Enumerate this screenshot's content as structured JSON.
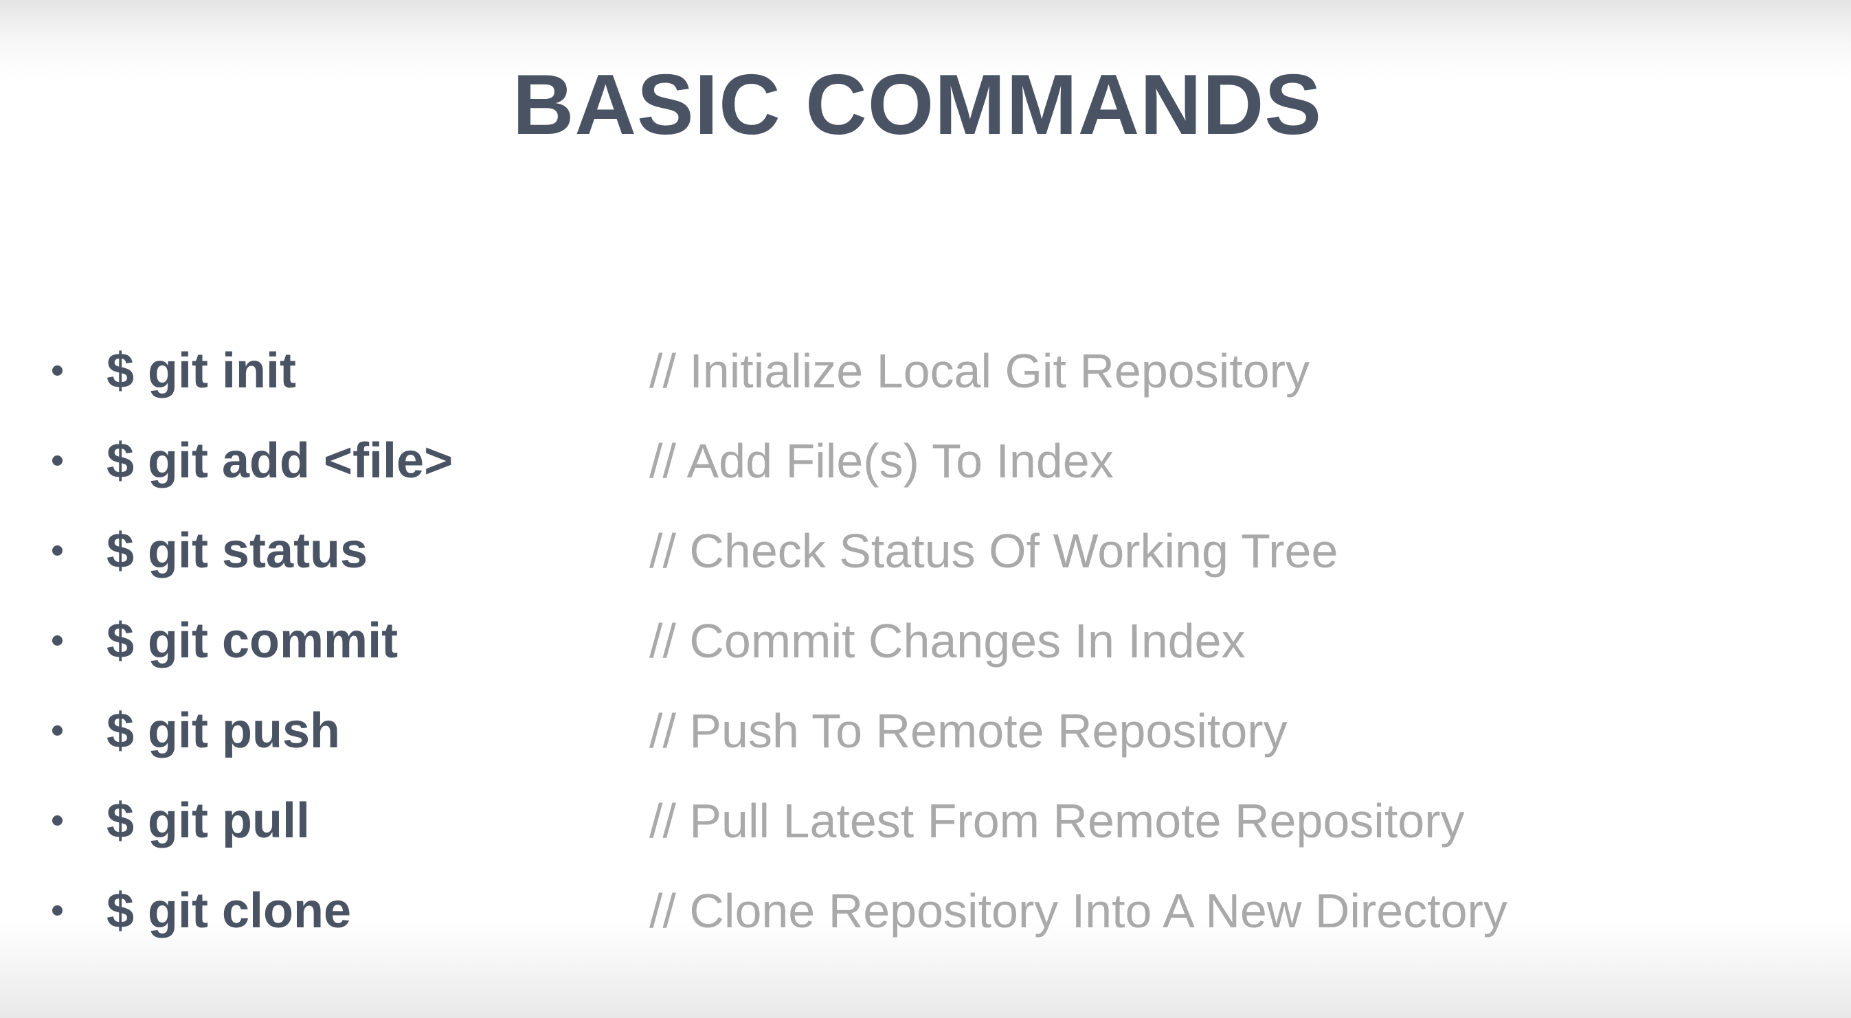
{
  "slide": {
    "title": "BASIC COMMANDS",
    "commands": [
      {
        "command": "$ git init",
        "comment": "// Initialize Local Git Repository"
      },
      {
        "command": "$ git add <file>",
        "comment": "// Add File(s) To Index"
      },
      {
        "command": "$ git status",
        "comment": "// Check Status Of Working Tree"
      },
      {
        "command": "$ git commit",
        "comment": "// Commit Changes In Index"
      },
      {
        "command": "$ git push",
        "comment": "// Push To Remote Repository"
      },
      {
        "command": "$ git pull",
        "comment": "// Pull Latest From Remote Repository"
      },
      {
        "command": "$ git clone",
        "comment": "// Clone Repository Into A New Directory"
      }
    ]
  },
  "colors": {
    "command_text": "#4a5364",
    "comment_text": "#a9a9a9",
    "background": "#ffffff"
  }
}
